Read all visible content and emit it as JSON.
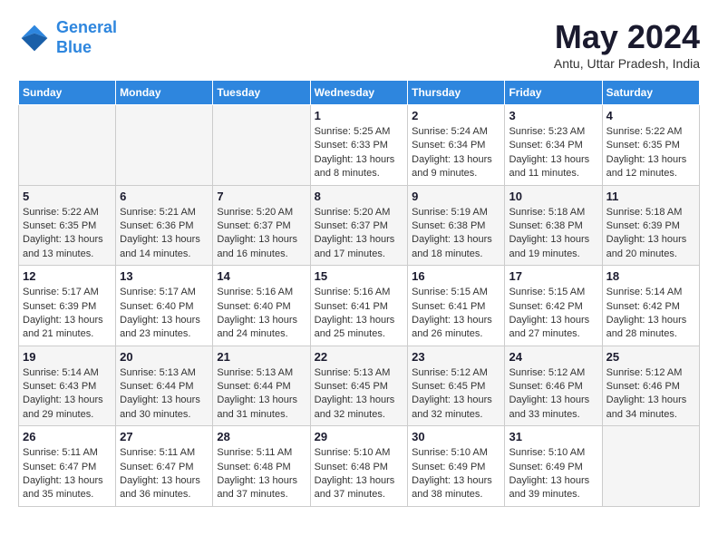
{
  "logo": {
    "line1": "General",
    "line2": "Blue"
  },
  "title": "May 2024",
  "location": "Antu, Uttar Pradesh, India",
  "weekdays": [
    "Sunday",
    "Monday",
    "Tuesday",
    "Wednesday",
    "Thursday",
    "Friday",
    "Saturday"
  ],
  "weeks": [
    [
      {
        "day": "",
        "info": ""
      },
      {
        "day": "",
        "info": ""
      },
      {
        "day": "",
        "info": ""
      },
      {
        "day": "1",
        "info": "Sunrise: 5:25 AM\nSunset: 6:33 PM\nDaylight: 13 hours and 8 minutes."
      },
      {
        "day": "2",
        "info": "Sunrise: 5:24 AM\nSunset: 6:34 PM\nDaylight: 13 hours and 9 minutes."
      },
      {
        "day": "3",
        "info": "Sunrise: 5:23 AM\nSunset: 6:34 PM\nDaylight: 13 hours and 11 minutes."
      },
      {
        "day": "4",
        "info": "Sunrise: 5:22 AM\nSunset: 6:35 PM\nDaylight: 13 hours and 12 minutes."
      }
    ],
    [
      {
        "day": "5",
        "info": "Sunrise: 5:22 AM\nSunset: 6:35 PM\nDaylight: 13 hours and 13 minutes."
      },
      {
        "day": "6",
        "info": "Sunrise: 5:21 AM\nSunset: 6:36 PM\nDaylight: 13 hours and 14 minutes."
      },
      {
        "day": "7",
        "info": "Sunrise: 5:20 AM\nSunset: 6:37 PM\nDaylight: 13 hours and 16 minutes."
      },
      {
        "day": "8",
        "info": "Sunrise: 5:20 AM\nSunset: 6:37 PM\nDaylight: 13 hours and 17 minutes."
      },
      {
        "day": "9",
        "info": "Sunrise: 5:19 AM\nSunset: 6:38 PM\nDaylight: 13 hours and 18 minutes."
      },
      {
        "day": "10",
        "info": "Sunrise: 5:18 AM\nSunset: 6:38 PM\nDaylight: 13 hours and 19 minutes."
      },
      {
        "day": "11",
        "info": "Sunrise: 5:18 AM\nSunset: 6:39 PM\nDaylight: 13 hours and 20 minutes."
      }
    ],
    [
      {
        "day": "12",
        "info": "Sunrise: 5:17 AM\nSunset: 6:39 PM\nDaylight: 13 hours and 21 minutes."
      },
      {
        "day": "13",
        "info": "Sunrise: 5:17 AM\nSunset: 6:40 PM\nDaylight: 13 hours and 23 minutes."
      },
      {
        "day": "14",
        "info": "Sunrise: 5:16 AM\nSunset: 6:40 PM\nDaylight: 13 hours and 24 minutes."
      },
      {
        "day": "15",
        "info": "Sunrise: 5:16 AM\nSunset: 6:41 PM\nDaylight: 13 hours and 25 minutes."
      },
      {
        "day": "16",
        "info": "Sunrise: 5:15 AM\nSunset: 6:41 PM\nDaylight: 13 hours and 26 minutes."
      },
      {
        "day": "17",
        "info": "Sunrise: 5:15 AM\nSunset: 6:42 PM\nDaylight: 13 hours and 27 minutes."
      },
      {
        "day": "18",
        "info": "Sunrise: 5:14 AM\nSunset: 6:42 PM\nDaylight: 13 hours and 28 minutes."
      }
    ],
    [
      {
        "day": "19",
        "info": "Sunrise: 5:14 AM\nSunset: 6:43 PM\nDaylight: 13 hours and 29 minutes."
      },
      {
        "day": "20",
        "info": "Sunrise: 5:13 AM\nSunset: 6:44 PM\nDaylight: 13 hours and 30 minutes."
      },
      {
        "day": "21",
        "info": "Sunrise: 5:13 AM\nSunset: 6:44 PM\nDaylight: 13 hours and 31 minutes."
      },
      {
        "day": "22",
        "info": "Sunrise: 5:13 AM\nSunset: 6:45 PM\nDaylight: 13 hours and 32 minutes."
      },
      {
        "day": "23",
        "info": "Sunrise: 5:12 AM\nSunset: 6:45 PM\nDaylight: 13 hours and 32 minutes."
      },
      {
        "day": "24",
        "info": "Sunrise: 5:12 AM\nSunset: 6:46 PM\nDaylight: 13 hours and 33 minutes."
      },
      {
        "day": "25",
        "info": "Sunrise: 5:12 AM\nSunset: 6:46 PM\nDaylight: 13 hours and 34 minutes."
      }
    ],
    [
      {
        "day": "26",
        "info": "Sunrise: 5:11 AM\nSunset: 6:47 PM\nDaylight: 13 hours and 35 minutes."
      },
      {
        "day": "27",
        "info": "Sunrise: 5:11 AM\nSunset: 6:47 PM\nDaylight: 13 hours and 36 minutes."
      },
      {
        "day": "28",
        "info": "Sunrise: 5:11 AM\nSunset: 6:48 PM\nDaylight: 13 hours and 37 minutes."
      },
      {
        "day": "29",
        "info": "Sunrise: 5:10 AM\nSunset: 6:48 PM\nDaylight: 13 hours and 37 minutes."
      },
      {
        "day": "30",
        "info": "Sunrise: 5:10 AM\nSunset: 6:49 PM\nDaylight: 13 hours and 38 minutes."
      },
      {
        "day": "31",
        "info": "Sunrise: 5:10 AM\nSunset: 6:49 PM\nDaylight: 13 hours and 39 minutes."
      },
      {
        "day": "",
        "info": ""
      }
    ]
  ]
}
